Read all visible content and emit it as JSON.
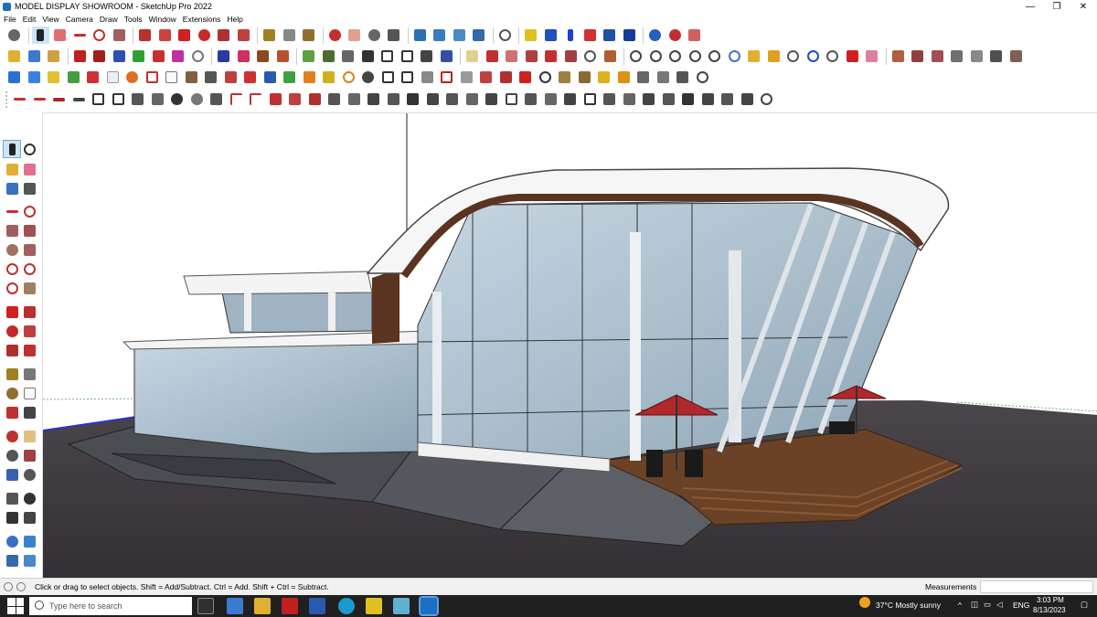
{
  "window": {
    "title": "MODEL DISPLAY SHOWROOM - SketchUp Pro 2022",
    "minimize": "—",
    "restore": "❐",
    "close": "✕"
  },
  "menu": [
    "File",
    "Edit",
    "View",
    "Camera",
    "Draw",
    "Tools",
    "Window",
    "Extensions",
    "Help"
  ],
  "status": {
    "hint": "Click or drag to select objects. Shift = Add/Subtract. Ctrl = Add. Shift + Ctrl = Subtract.",
    "measurements_label": "Measurements",
    "measurements_value": ""
  },
  "taskbar": {
    "search_placeholder": "Type here to search",
    "weather": "37°C  Mostly sunny",
    "language": "ENG",
    "time": "3:03 PM",
    "date": "8/13/2023"
  },
  "colors": {
    "sky": "#ffffff",
    "ground": "#3d3a3e",
    "deck": "#6b4226",
    "glass": "#a9c0d0",
    "umbrella": "#b1282c",
    "taskbar": "#202020",
    "accent": "#1c6fc2"
  }
}
